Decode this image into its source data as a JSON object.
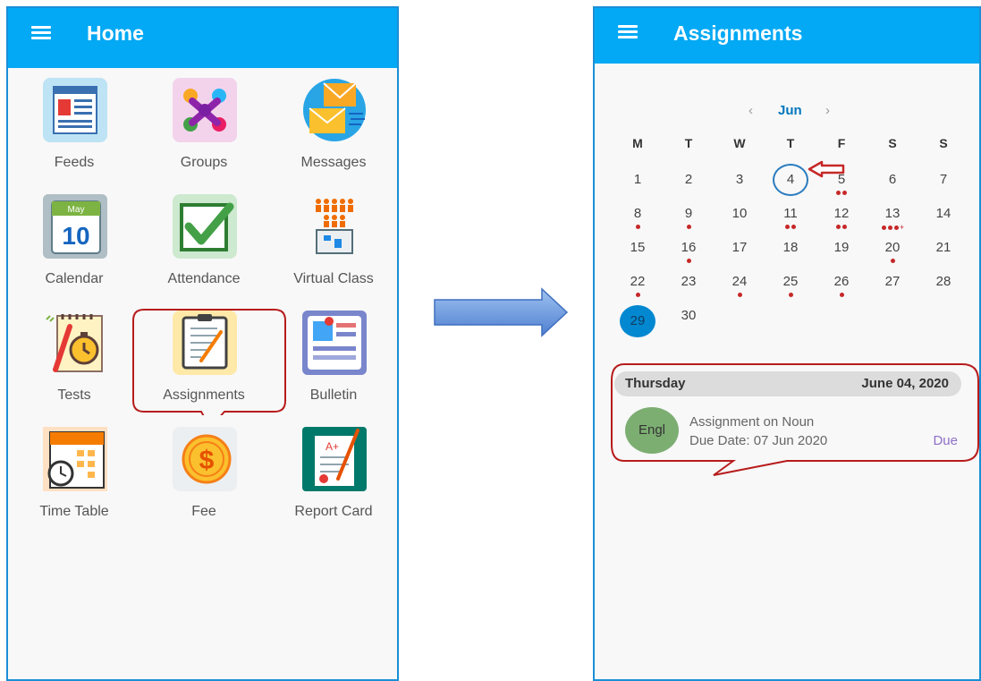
{
  "home": {
    "title": "Home",
    "tiles": [
      {
        "label": "Feeds",
        "icon": "feeds-icon"
      },
      {
        "label": "Groups",
        "icon": "groups-icon"
      },
      {
        "label": "Messages",
        "icon": "messages-icon"
      },
      {
        "label": "Calendar",
        "icon": "calendar-icon"
      },
      {
        "label": "Attendance",
        "icon": "attendance-icon"
      },
      {
        "label": "Virtual Class",
        "icon": "virtual-class-icon"
      },
      {
        "label": "Tests",
        "icon": "tests-icon"
      },
      {
        "label": "Assignments",
        "icon": "assignments-icon"
      },
      {
        "label": "Bulletin",
        "icon": "bulletin-icon"
      },
      {
        "label": "Time Table",
        "icon": "time-table-icon"
      },
      {
        "label": "Fee",
        "icon": "fee-icon"
      },
      {
        "label": "Report Card",
        "icon": "report-card-icon"
      }
    ],
    "calendar_icon_month": "May",
    "calendar_icon_day": "10"
  },
  "assignments": {
    "title": "Assignments",
    "month": "Jun",
    "weekdays": [
      "M",
      "T",
      "W",
      "T",
      "F",
      "S",
      "S"
    ],
    "days": [
      {
        "day": "1",
        "dots": 0
      },
      {
        "day": "2",
        "dots": 0
      },
      {
        "day": "3",
        "dots": 0
      },
      {
        "day": "4",
        "dots": 0,
        "circled": true
      },
      {
        "day": "5",
        "dots": 2
      },
      {
        "day": "6",
        "dots": 0
      },
      {
        "day": "7",
        "dots": 0
      },
      {
        "day": "8",
        "dots": 1
      },
      {
        "day": "9",
        "dots": 1
      },
      {
        "day": "10",
        "dots": 0
      },
      {
        "day": "11",
        "dots": 2
      },
      {
        "day": "12",
        "dots": 2
      },
      {
        "day": "13",
        "dots": 3,
        "plus": true
      },
      {
        "day": "14",
        "dots": 0
      },
      {
        "day": "15",
        "dots": 0
      },
      {
        "day": "16",
        "dots": 1
      },
      {
        "day": "17",
        "dots": 0
      },
      {
        "day": "18",
        "dots": 0
      },
      {
        "day": "19",
        "dots": 0
      },
      {
        "day": "20",
        "dots": 1
      },
      {
        "day": "21",
        "dots": 0
      },
      {
        "day": "22",
        "dots": 1
      },
      {
        "day": "23",
        "dots": 0
      },
      {
        "day": "24",
        "dots": 1
      },
      {
        "day": "25",
        "dots": 1
      },
      {
        "day": "26",
        "dots": 1
      },
      {
        "day": "27",
        "dots": 0
      },
      {
        "day": "28",
        "dots": 0
      },
      {
        "day": "29",
        "dots": 0,
        "today": true
      },
      {
        "day": "30",
        "dots": 0
      }
    ],
    "selected": {
      "weekday": "Thursday",
      "date": "June 04, 2020",
      "subject_abbr": "Engl",
      "assignment_title": "Assignment on Noun",
      "due_date": "Due Date: 07 Jun 2020",
      "status": "Due"
    },
    "colors": {
      "appbar": "#03a9f4",
      "today": "#0288d1",
      "event_dot": "#c62828",
      "due": "#8e6fc9",
      "highlight": "#c62828"
    }
  }
}
